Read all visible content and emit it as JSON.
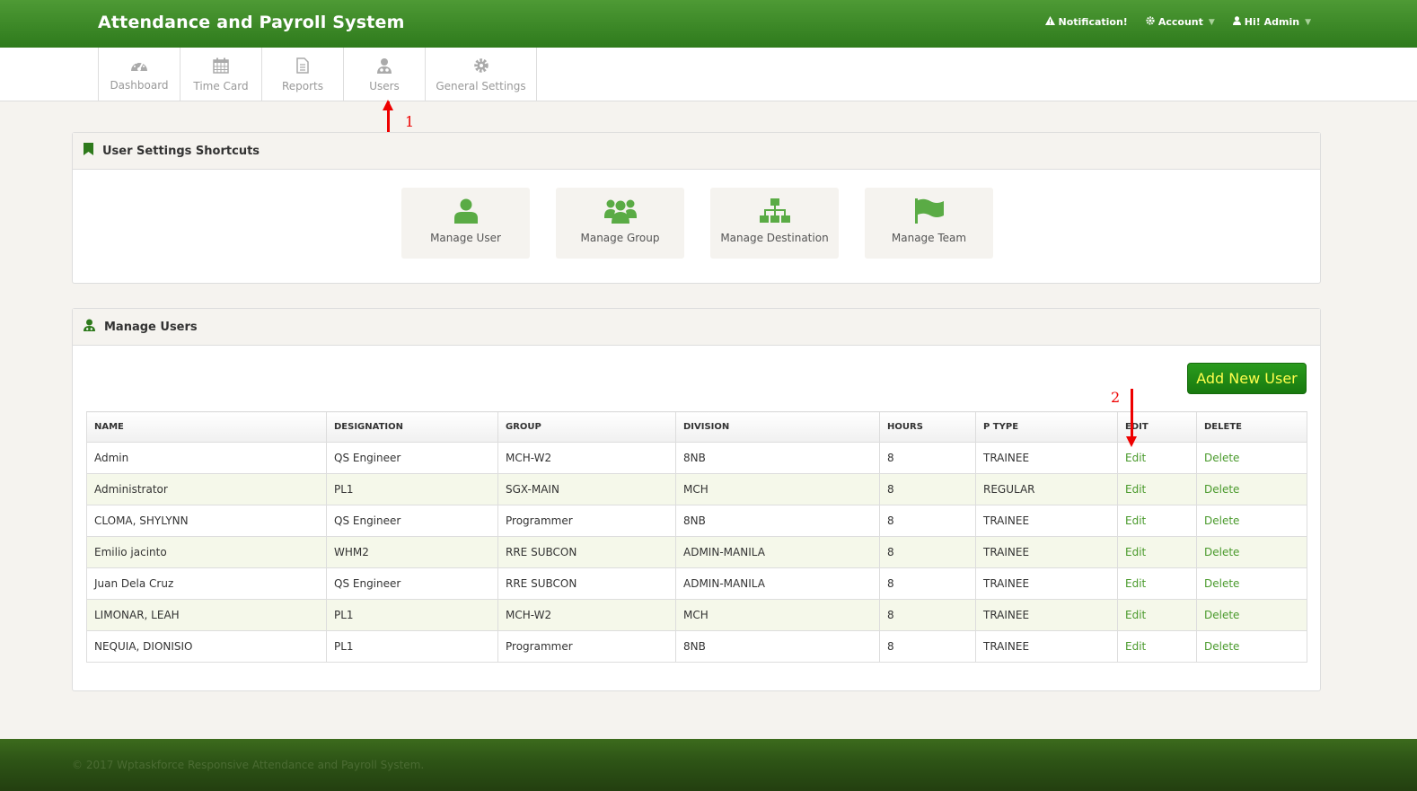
{
  "header": {
    "title": "Attendance and Payroll System",
    "notification": "Notification!",
    "account": "Account",
    "greeting": "Hi! Admin"
  },
  "tabs": [
    {
      "label": "Dashboard",
      "icon": "dashboard-icon"
    },
    {
      "label": "Time Card",
      "icon": "calendar-icon"
    },
    {
      "label": "Reports",
      "icon": "document-icon"
    },
    {
      "label": "Users",
      "icon": "user-icon"
    },
    {
      "label": "General Settings",
      "icon": "gear-icon"
    }
  ],
  "annotations": {
    "one": "1",
    "two": "2"
  },
  "shortcuts_panel": {
    "title": "User Settings Shortcuts",
    "items": [
      {
        "label": "Manage User",
        "icon": "user-icon"
      },
      {
        "label": "Manage Group",
        "icon": "group-icon"
      },
      {
        "label": "Manage Destination",
        "icon": "sitemap-icon"
      },
      {
        "label": "Manage Team",
        "icon": "flag-icon"
      }
    ]
  },
  "users_panel": {
    "title": "Manage Users",
    "add_button": "Add New User",
    "columns": [
      "NAME",
      "DESIGNATION",
      "GROUP",
      "DIVISION",
      "HOURS",
      "P TYPE",
      "EDIT",
      "DELETE"
    ],
    "rows": [
      {
        "name": "Admin",
        "designation": "QS Engineer",
        "group": "MCH-W2",
        "division": "8NB",
        "hours": "8",
        "ptype": "TRAINEE",
        "edit": "Edit",
        "delete": "Delete"
      },
      {
        "name": "Administrator",
        "designation": "PL1",
        "group": "SGX-MAIN",
        "division": "MCH",
        "hours": "8",
        "ptype": "REGULAR",
        "edit": "Edit",
        "delete": "Delete"
      },
      {
        "name": "CLOMA, SHYLYNN",
        "designation": "QS Engineer",
        "group": "Programmer",
        "division": "8NB",
        "hours": "8",
        "ptype": "TRAINEE",
        "edit": "Edit",
        "delete": "Delete"
      },
      {
        "name": "Emilio jacinto",
        "designation": "WHM2",
        "group": "RRE SUBCON",
        "division": "ADMIN-MANILA",
        "hours": "8",
        "ptype": "TRAINEE",
        "edit": "Edit",
        "delete": "Delete"
      },
      {
        "name": "Juan Dela Cruz",
        "designation": "QS Engineer",
        "group": "RRE SUBCON",
        "division": "ADMIN-MANILA",
        "hours": "8",
        "ptype": "TRAINEE",
        "edit": "Edit",
        "delete": "Delete"
      },
      {
        "name": "LIMONAR, LEAH",
        "designation": "PL1",
        "group": "MCH-W2",
        "division": "MCH",
        "hours": "8",
        "ptype": "TRAINEE",
        "edit": "Edit",
        "delete": "Delete"
      },
      {
        "name": "NEQUIA, DIONISIO",
        "designation": "PL1",
        "group": "Programmer",
        "division": "8NB",
        "hours": "8",
        "ptype": "TRAINEE",
        "edit": "Edit",
        "delete": "Delete"
      }
    ]
  },
  "footer": {
    "text": "© 2017 Wptaskforce Responsive Attendance and Payroll System."
  },
  "colors": {
    "brand_green": "#3a8a27",
    "link_green": "#4a9a2c",
    "button_text": "#ffff4d",
    "annotation_red": "#e00000"
  }
}
